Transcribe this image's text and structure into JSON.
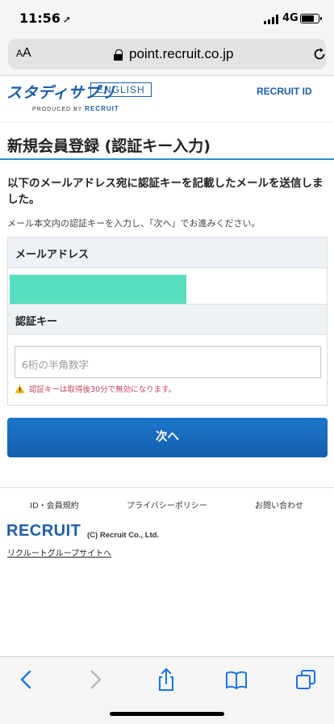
{
  "status_bar": {
    "time": "11:56",
    "network": "4G"
  },
  "browser": {
    "text_size_label": "AA",
    "url": "point.recruit.co.jp"
  },
  "header": {
    "logo_jp": "スタディサプリ",
    "logo_en": "ENGLISH",
    "produced_by": "PRODUCED BY",
    "produced_brand": "RECRUIT",
    "recruit_id": "RECRUIT ID"
  },
  "page": {
    "title": "新規会員登録 (認証キー入力)",
    "lead": "以下のメールアドレス宛に認証キーを記載したメールを送信しました。",
    "sub": "メール本文内の認証キーを入力し、「次へ」でお進みください。"
  },
  "form": {
    "email_label": "メールアドレス",
    "key_label": "認証キー",
    "key_placeholder": "6桁の半角数字",
    "key_warning": "認証キーは取得後30分で無効になります。",
    "mask_color": "#56dec0"
  },
  "submit": {
    "label": "次へ"
  },
  "footer": {
    "links": [
      "ID・会員規約",
      "プライバシーポリシー",
      "お問い合わせ"
    ],
    "logo": "RECRUIT",
    "copyright": "(C) Recruit Co., Ltd.",
    "group_link": "リクルートグループサイトへ"
  },
  "toolbar": {
    "icons": [
      "back-icon",
      "forward-icon",
      "share-icon",
      "bookmarks-icon",
      "tabs-icon"
    ]
  },
  "colors": {
    "accent": "#1f5ea8",
    "button": "#1d76c9",
    "warning": "#c8455b",
    "title_rule": "#2f8fc9"
  }
}
